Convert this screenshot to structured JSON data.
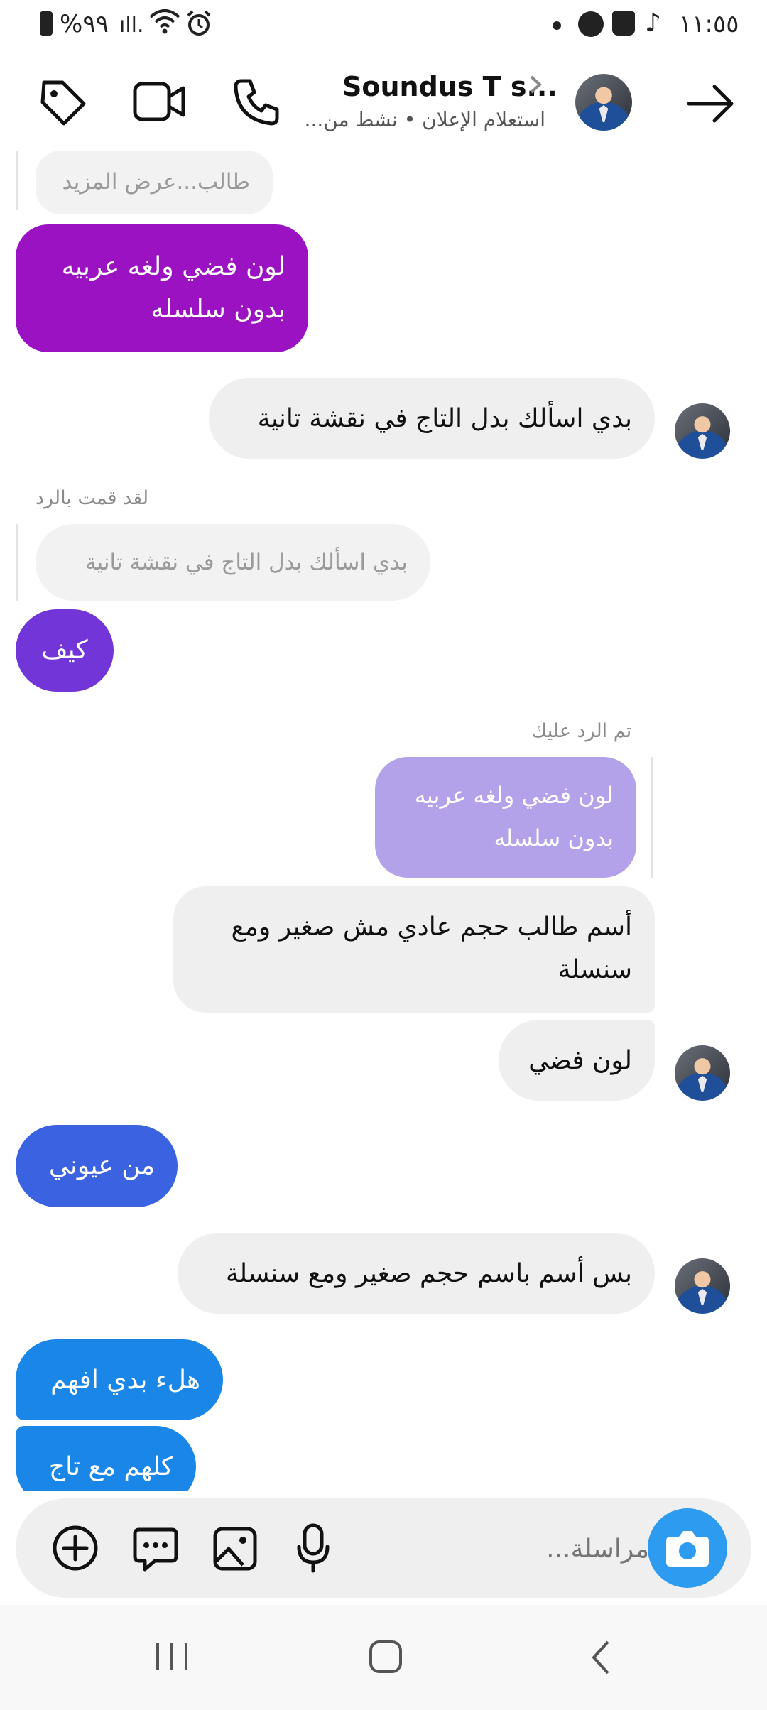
{
  "status_bar": {
    "time": "١١:٥٥",
    "battery": "%٩٩"
  },
  "header": {
    "title": "Soundus T s...",
    "subtitle": "استعلام الإعلان • نشط من..."
  },
  "messages": {
    "m0_preview": "طالب...عرض المزيد",
    "m1": "لون فضي ولغه عربيه\nبدون سلسله",
    "m2": "بدي اسألك بدل التاج في نقشة تانية",
    "m3_caption": "لقد قمت بالرد",
    "m3_preview": "بدي اسألك بدل التاج في نقشة تانية",
    "m3": "كيف",
    "m4_caption": "تم الرد عليك",
    "m4_preview": "لون فضي ولغه عربيه\nبدون سلسله",
    "m4": "أسم طالب حجم عادي مش صغير ومع\nسنسلة",
    "m5": "لون فضي",
    "m6": "من عيوني",
    "m7": "بس أسم باسم حجم صغير ومع سنسلة",
    "m8": "هلء بدي افهم",
    "m9": "كلهم مع تاج"
  },
  "composer": {
    "placeholder": "مراسلة..."
  },
  "colors": {
    "purple_1": "#9b12c3",
    "purple_2": "#7236d8",
    "blue_1": "#3b62e0",
    "blue_2": "#1a86e8",
    "reply_highlight": "#b3a2ea",
    "camera": "#2d9bf0"
  },
  "icons": [
    "tag-icon",
    "video-call-icon",
    "phone-icon",
    "chevron-right-icon",
    "back-arrow-icon",
    "plus-icon",
    "sticker-icon",
    "gallery-icon",
    "mic-icon",
    "camera-icon"
  ]
}
